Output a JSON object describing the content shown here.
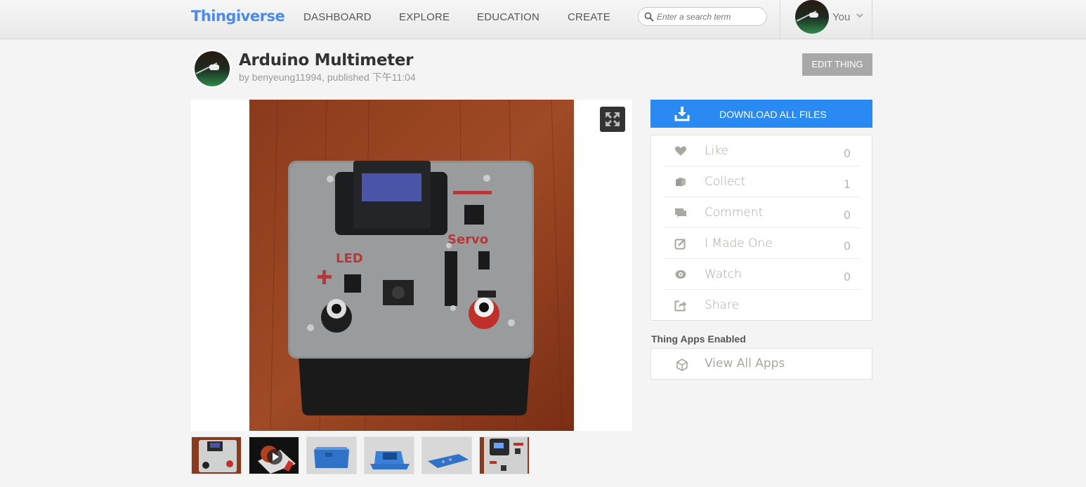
{
  "header": {
    "logo": "Thingiverse",
    "nav": [
      {
        "label": "DASHBOARD"
      },
      {
        "label": "EXPLORE"
      },
      {
        "label": "EDUCATION"
      },
      {
        "label": "CREATE"
      }
    ],
    "search": {
      "placeholder": "Enter a search term",
      "value": ""
    },
    "user": {
      "label": "You"
    }
  },
  "thing": {
    "title": "Arduino Multimeter",
    "by_prefix": "by ",
    "author": "benyeung11994",
    "published": ", published 下午11:04",
    "edit_label": "EDIT THING"
  },
  "gallery": {
    "expand_icon": "expand-icon",
    "thumbnails": [
      {
        "kind": "photo",
        "desc": "multimeter front photo"
      },
      {
        "kind": "video",
        "desc": "video with play button"
      },
      {
        "kind": "render",
        "desc": "blue case render"
      },
      {
        "kind": "render",
        "desc": "blue display bezel render"
      },
      {
        "kind": "render",
        "desc": "blue top plate render"
      },
      {
        "kind": "photo",
        "desc": "multimeter close-up photo"
      }
    ]
  },
  "sidebar": {
    "download_label": "DOWNLOAD ALL FILES",
    "actions": [
      {
        "label": "Like",
        "count": "0",
        "icon": "heart-icon"
      },
      {
        "label": "Collect",
        "count": "1",
        "icon": "collect-icon"
      },
      {
        "label": "Comment",
        "count": "0",
        "icon": "comment-icon"
      },
      {
        "label": "I Made One",
        "count": "0",
        "icon": "made-one-icon"
      },
      {
        "label": "Watch",
        "count": "0",
        "icon": "eye-icon"
      },
      {
        "label": "Share",
        "count": "",
        "icon": "share-icon"
      }
    ],
    "apps_title": "Thing Apps Enabled",
    "apps_link": "View All Apps"
  },
  "colors": {
    "brand": "#4a8af4",
    "download": "#2a8af4",
    "edit_button": "#a8a8a8",
    "action_text": "#a7a8a2"
  }
}
